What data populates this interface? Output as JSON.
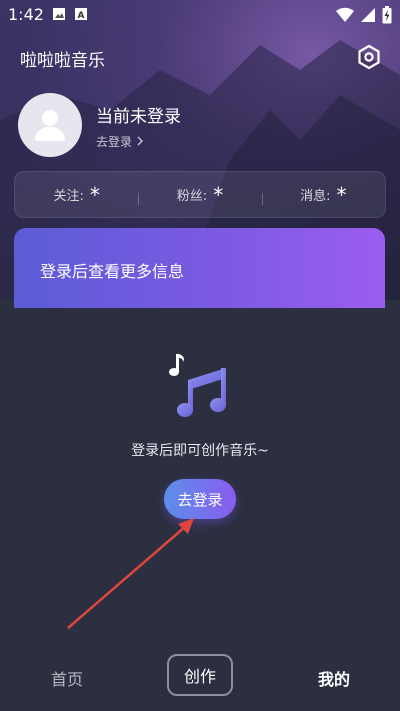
{
  "status_bar": {
    "time": "1:42",
    "icons_left": [
      "image-icon",
      "a-box-icon"
    ],
    "icons_right": [
      "wifi-icon",
      "signal-icon",
      "battery-charging-icon"
    ]
  },
  "header": {
    "title": "啦啦啦音乐",
    "settings_icon": "settings-hexagon-icon"
  },
  "profile": {
    "status": "当前未登录",
    "login_link": "去登录"
  },
  "stats": [
    {
      "label": "关注:",
      "value": "*"
    },
    {
      "label": "粉丝:",
      "value": "*"
    },
    {
      "label": "消息:",
      "value": "*"
    }
  ],
  "promo": {
    "text": "登录后查看更多信息"
  },
  "empty_state": {
    "icon": "music-note-icon",
    "text": "登录后即可创作音乐~",
    "button_label": "去登录"
  },
  "tabbar": {
    "home": "首页",
    "create": "创作",
    "mine": "我的"
  },
  "colors": {
    "accent_start": "#5b8fe8",
    "accent_end": "#8a5cf0",
    "annotation_arrow": "#e0463c"
  }
}
